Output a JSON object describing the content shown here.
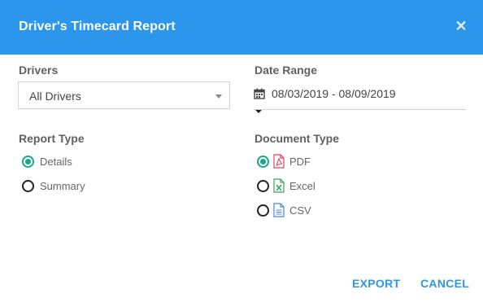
{
  "dialog": {
    "title": "Driver's Timecard Report",
    "close_icon": "close-icon"
  },
  "drivers": {
    "label": "Drivers",
    "selected": "All Drivers"
  },
  "date_range": {
    "label": "Date Range",
    "value": "08/03/2019 - 08/09/2019",
    "icon": "calendar-icon"
  },
  "report_type": {
    "label": "Report Type",
    "options": [
      {
        "label": "Details",
        "checked": true
      },
      {
        "label": "Summary",
        "checked": false
      }
    ]
  },
  "document_type": {
    "label": "Document Type",
    "options": [
      {
        "label": "PDF",
        "checked": true,
        "icon": "pdf-file-icon"
      },
      {
        "label": "Excel",
        "checked": false,
        "icon": "excel-file-icon"
      },
      {
        "label": "CSV",
        "checked": false,
        "icon": "csv-file-icon"
      }
    ]
  },
  "actions": {
    "export_label": "EXPORT",
    "cancel_label": "CANCEL"
  },
  "colors": {
    "header": "#2b96ec",
    "accent": "#2b96ec",
    "radio_checked": "#1aa68c",
    "pdf": "#e0445a",
    "excel": "#3aa55a",
    "csv": "#4a86d8"
  }
}
